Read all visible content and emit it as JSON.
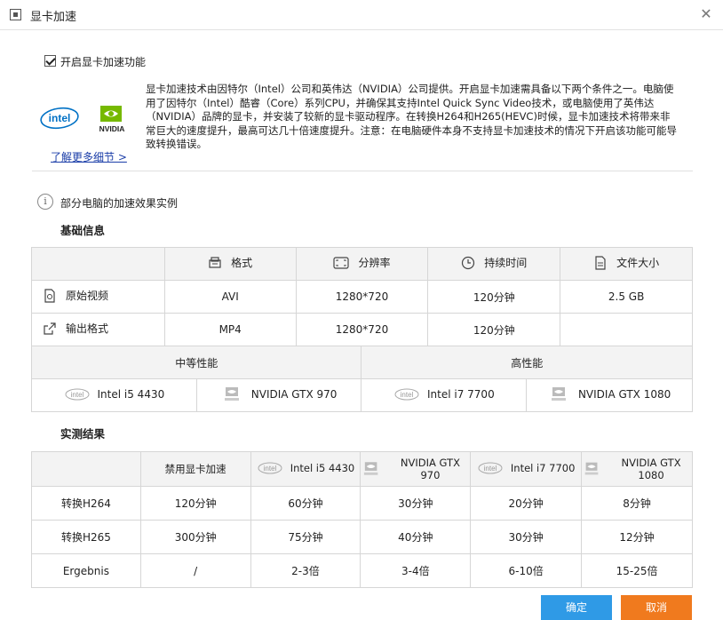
{
  "window": {
    "title": "显卡加速"
  },
  "checkbox": {
    "label": "开启显卡加速功能",
    "checked": true
  },
  "logos": {
    "intel": "intel",
    "nvidia": "NVIDIA"
  },
  "description": "显卡加速技术由因特尔（Intel）公司和英伟达（NVIDIA）公司提供。开启显卡加速需具备以下两个条件之一。电脑使用了因特尔（Intel）酷睿（Core）系列CPU，并确保其支持Intel Quick Sync Video技术，或电脑使用了英伟达（NVIDIA）品牌的显卡，并安装了较新的显卡驱动程序。在转换H264和H265(HEVC)时候，显卡加速技术将带来非常巨大的速度提升，最高可达几十倍速度提升。注意：在电脑硬件本身不支持显卡加速技术的情况下开启该功能可能导致转换错误。",
  "learn_more": "了解更多细节 >",
  "section_note": "部分电脑的加速效果实例",
  "basic_info": {
    "heading": "基础信息",
    "columns": [
      "格式",
      "分辨率",
      "持续时间",
      "文件大小"
    ],
    "rows": [
      {
        "label": "原始视频",
        "cells": [
          "AVI",
          "1280*720",
          "120分钟",
          "2.5 GB"
        ]
      },
      {
        "label": "输出格式",
        "cells": [
          "MP4",
          "1280*720",
          "120分钟",
          ""
        ]
      }
    ]
  },
  "performance": {
    "groups": [
      "中等性能",
      "高性能"
    ],
    "items": [
      "Intel i5 4430",
      "NVIDIA GTX 970",
      "Intel i7 7700",
      "NVIDIA GTX 1080"
    ]
  },
  "results": {
    "heading": "实测结果",
    "columns": [
      "禁用显卡加速",
      "Intel i5 4430",
      "NVIDIA GTX 970",
      "Intel i7 7700",
      "NVIDIA GTX 1080"
    ],
    "rows": [
      {
        "label": "转换H264",
        "cells": [
          "120分钟",
          "60分钟",
          "30分钟",
          "20分钟",
          "8分钟"
        ]
      },
      {
        "label": "转换H265",
        "cells": [
          "300分钟",
          "75分钟",
          "40分钟",
          "30分钟",
          "12分钟"
        ]
      },
      {
        "label": "Ergebnis",
        "cells": [
          "/",
          "2-3倍",
          "3-4倍",
          "6-10倍",
          "15-25倍"
        ]
      }
    ]
  },
  "buttons": {
    "ok": "确定",
    "cancel": "取消"
  },
  "colors": {
    "ok": "#2f9ae6",
    "cancel": "#f07a1e",
    "intel": "#0071c5",
    "nvidia": "#76b900",
    "link": "#1a3da8"
  }
}
